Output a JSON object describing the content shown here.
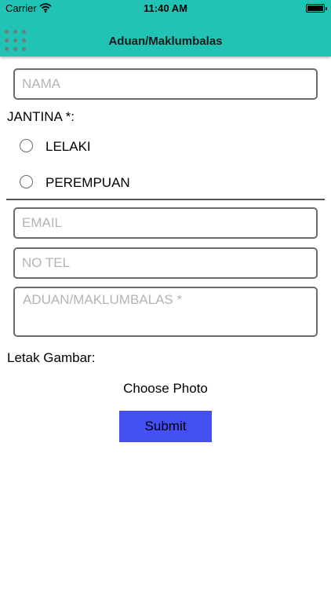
{
  "status_bar": {
    "carrier": "Carrier",
    "time": "11:40 AM",
    "wifi_icon": "wifi-icon",
    "battery_icon": "battery-icon"
  },
  "header": {
    "title": "Aduan/Maklumbalas",
    "menu_icon": "grid-menu-icon",
    "background_color": "#21c4b4"
  },
  "form": {
    "name_placeholder": "NAMA",
    "gender_label": "JANTINA *:",
    "gender_options": [
      {
        "label": "LELAKI",
        "selected": false
      },
      {
        "label": "PEREMPUAN",
        "selected": false
      }
    ],
    "email_placeholder": "EMAIL",
    "phone_placeholder": "NO TEL",
    "complaint_placeholder": "ADUAN/MAKLUMBALAS *",
    "image_label": "Letak Gambar:",
    "choose_photo_label": "Choose Photo",
    "submit_label": "Submit",
    "submit_color": "#4450f2"
  }
}
